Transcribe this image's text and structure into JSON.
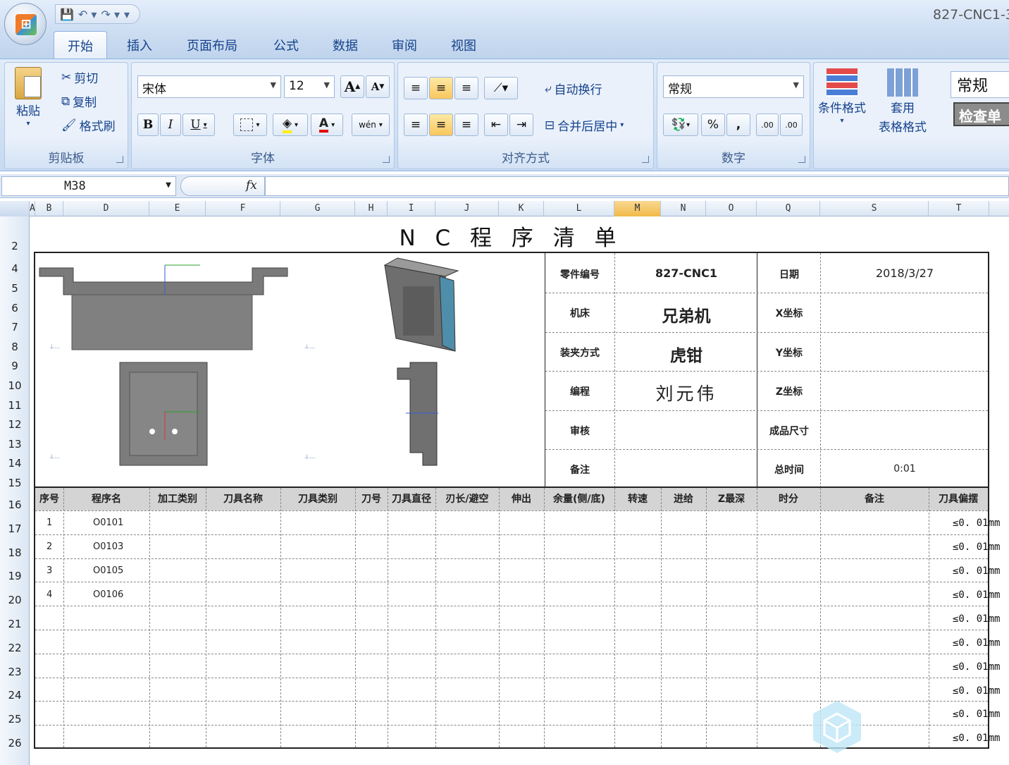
{
  "app": {
    "title": "827-CNC1-3"
  },
  "quick_access": {
    "save_icon": "save-icon",
    "undo_icon": "undo-icon",
    "redo_icon": "redo-icon"
  },
  "tabs": [
    "开始",
    "插入",
    "页面布局",
    "公式",
    "数据",
    "审阅",
    "视图"
  ],
  "ribbon": {
    "clipboard": {
      "paste": "粘贴",
      "cut": "剪切",
      "copy": "复制",
      "format_painter": "格式刷",
      "label": "剪贴板"
    },
    "font": {
      "name": "宋体",
      "size": "12",
      "label": "字体",
      "bold": "B",
      "italic": "I",
      "underline": "U",
      "grow": "A",
      "shrink": "A",
      "color": "A",
      "phonetic": "wén"
    },
    "alignment": {
      "wrap": "自动换行",
      "merge": "合并后居中",
      "label": "对齐方式"
    },
    "number": {
      "format": "常规",
      "label": "数字",
      "percent": "%",
      "comma": ",",
      "inc_decimal": ".00",
      "dec_decimal": ".00"
    },
    "styles": {
      "conditional": "条件格式",
      "table_format_1": "套用",
      "table_format_2": "表格格式",
      "cell_style": "常规",
      "check": "检查单"
    }
  },
  "formula_bar": {
    "name_box": "M38",
    "fx": "fx",
    "value": ""
  },
  "columns": [
    "A",
    "B",
    "D",
    "E",
    "F",
    "G",
    "H",
    "I",
    "J",
    "K",
    "L",
    "M",
    "N",
    "O",
    "Q",
    "S",
    "T"
  ],
  "rows": [
    "2",
    "4",
    "5",
    "6",
    "7",
    "8",
    "9",
    "10",
    "11",
    "12",
    "13",
    "14",
    "15",
    "16",
    "17",
    "18",
    "19",
    "20",
    "21",
    "22",
    "23",
    "24",
    "25",
    "26"
  ],
  "sheet": {
    "title": "N C 程 序 清 单",
    "info": [
      {
        "label": "零件编号",
        "value": "827-CNC1",
        "label2": "日期",
        "value2": "2018/3/27"
      },
      {
        "label": "机床",
        "value": "兄弟机",
        "label2": "X坐标",
        "value2": ""
      },
      {
        "label": "装夹方式",
        "value": "虎钳",
        "label2": "Y坐标",
        "value2": ""
      },
      {
        "label": "编程",
        "value": "刘元伟",
        "label2": "Z坐标",
        "value2": ""
      },
      {
        "label": "审核",
        "value": "",
        "label2": "成品尺寸",
        "value2": ""
      },
      {
        "label": "备注",
        "value": "",
        "label2": "总时间",
        "value2": "0:01"
      }
    ],
    "table_headers": [
      "序号",
      "程序名",
      "加工类别",
      "刀具名称",
      "刀具类别",
      "刀号",
      "刀具直径",
      "刃长/避空",
      "伸出",
      "余量(侧/底)",
      "转速",
      "进给",
      "Z最深",
      "时分",
      "备注",
      "刀具偏摆"
    ],
    "table_rows": [
      {
        "no": "1",
        "program": "O0101"
      },
      {
        "no": "2",
        "program": "O0103"
      },
      {
        "no": "3",
        "program": "O0105"
      },
      {
        "no": "4",
        "program": "O0106"
      }
    ],
    "tolerance": "≤0. 01mm"
  }
}
